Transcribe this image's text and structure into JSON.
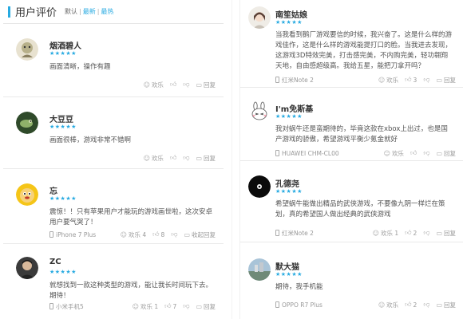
{
  "header": {
    "title": "用户评价",
    "sort_options": [
      {
        "label": "默认"
      },
      {
        "label": "最新"
      },
      {
        "label": "最热"
      }
    ]
  },
  "colors": {
    "accent": "#27aae1"
  },
  "reviews_left": [
    {
      "username": "烟酒碧人",
      "stars": "★★★★★",
      "text": "画面清晰，操作有趣",
      "device": "",
      "actions": {
        "happy": "欢乐",
        "like": "",
        "dislike": "",
        "reply": "回复"
      },
      "avatar_icon": "cartoon-avatar-icon"
    },
    {
      "username": "大豆豆",
      "stars": "★★★★★",
      "text": "画面很棒，游戏非常不错啊",
      "device": "",
      "actions": {
        "happy": "欢乐",
        "like": "",
        "dislike": "",
        "reply": "回复"
      },
      "avatar_icon": "lizard-avatar-icon"
    },
    {
      "username": "忘",
      "stars": "★★★★★",
      "text": "震惊！！只有苹果用户才能玩的游戏画世啦，这次安卓用户要气哭了！",
      "device": "iPhone 7 Plus",
      "actions": {
        "happy": "欢乐 4",
        "like": "8",
        "dislike": "",
        "reply": "收起回复"
      },
      "avatar_icon": "monkey-avatar-icon"
    },
    {
      "username": "ZC",
      "stars": "★★★★★",
      "text": "就想找到一款这种类型的游戏，能让我长时间玩下去。期待！",
      "device": "小米手机5",
      "actions": {
        "happy": "欢乐 1",
        "like": "7",
        "dislike": "",
        "reply": "回复"
      },
      "avatar_icon": "person-avatar-icon"
    }
  ],
  "reviews_right": [
    {
      "username": "南笙姑娘",
      "stars": "★★★★★",
      "text": "当我看到鹅厂游戏要信的时候，我兴奋了。这是什么样的游戏佳作，这是什么样的游戏能提打口的脸。当我进去发现，这游戏3D特效完美，打击感完美，不内购完美，轻功翱翔天地，自由感超级高。我给五星，能把刀拿开吗？",
      "device": "红米Note 2",
      "actions": {
        "happy": "欢乐",
        "like": "3",
        "dislike": "",
        "reply": "回复"
      },
      "avatar_icon": "girl-avatar-icon"
    },
    {
      "username": "I'm免斯基",
      "stars": "★★★★★",
      "text": "我对蜗牛还是蛮期待的，毕竟这款在xbox上出过，也是国产游戏的骄傲，希望游戏平衡少氪金就好",
      "device": "HUAWEI CHM-CL00",
      "actions": {
        "happy": "欢乐",
        "like": "",
        "dislike": "",
        "reply": "回复"
      },
      "avatar_icon": "rabbit-avatar-icon"
    },
    {
      "username": "孔德尧",
      "stars": "★★★★★",
      "text": "希望蜗牛能做出精品的武侠游戏，不要像九阴一样烂在策划，真的希望国人做出经典的武侠游戏",
      "device": "红米Note 2",
      "actions": {
        "happy": "欢乐 1",
        "like": "2",
        "dislike": "",
        "reply": "回复"
      },
      "avatar_icon": "dark-circle-avatar-icon"
    },
    {
      "username": "默大猫",
      "stars": "★★★★★",
      "text": "期待，我手机能",
      "device": "OPPO R7 Plus",
      "actions": {
        "happy": "欢乐",
        "like": "2",
        "dislike": "",
        "reply": "回复"
      },
      "avatar_icon": "landscape-avatar-icon"
    }
  ]
}
